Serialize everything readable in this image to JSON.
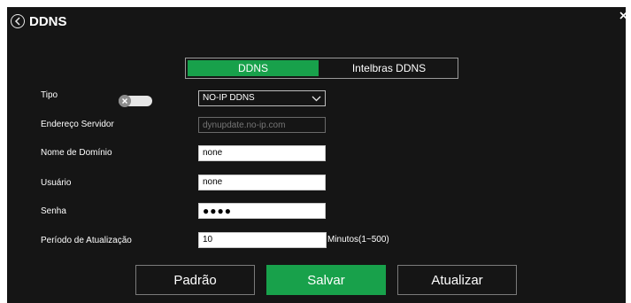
{
  "title": "DDNS",
  "tabs": [
    {
      "label": "DDNS",
      "active": true
    },
    {
      "label": "Intelbras DDNS",
      "active": false
    }
  ],
  "form": {
    "tipo": {
      "label": "Tipo",
      "enabled": false,
      "value": "NO-IP DDNS"
    },
    "server": {
      "label": "Endereço Servidor",
      "placeholder": "dynupdate.no-ip.com"
    },
    "domain": {
      "label": "Nome de Domínio",
      "value": "none"
    },
    "user": {
      "label": "Usuário",
      "value": "none"
    },
    "password": {
      "label": "Senha",
      "value": "●●●●"
    },
    "period": {
      "label": "Período de Atualização",
      "value": "10",
      "unit": "Minutos(1~500)"
    }
  },
  "buttons": {
    "default": "Padrão",
    "save": "Salvar",
    "refresh": "Atualizar"
  },
  "colors": {
    "accent": "#18a14b",
    "background": "#151515"
  }
}
